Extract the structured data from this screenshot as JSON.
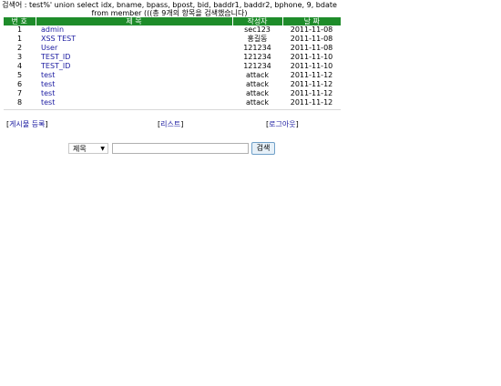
{
  "search_info": {
    "line1": "검색어 : test%' union select idx, bname, bpass, bpost, bid, baddr1, baddr2, bphone, 9, bdate",
    "line2": "from member  (((총 9개의 항목을 검색했습니다)"
  },
  "table": {
    "headers": [
      "번 호",
      "제 목",
      "작성자",
      "날 짜"
    ],
    "rows": [
      {
        "num": "1",
        "title": "admin",
        "writer": "sec123",
        "date": "2011-11-08"
      },
      {
        "num": "1",
        "title": "XSS TEST",
        "writer": "홍길동",
        "date": "2011-11-08"
      },
      {
        "num": "2",
        "title": "User",
        "writer": "121234",
        "date": "2011-11-08"
      },
      {
        "num": "3",
        "title": "TEST_ID",
        "writer": "121234",
        "date": "2011-11-10"
      },
      {
        "num": "4",
        "title": "TEST_ID",
        "writer": "121234",
        "date": "2011-11-10"
      },
      {
        "num": "5",
        "title": "test",
        "writer": "attack",
        "date": "2011-11-12"
      },
      {
        "num": "6",
        "title": "test",
        "writer": "attack",
        "date": "2011-11-12"
      },
      {
        "num": "7",
        "title": "test",
        "writer": "attack",
        "date": "2011-11-12"
      },
      {
        "num": "8",
        "title": "test",
        "writer": "attack",
        "date": "2011-11-12"
      }
    ]
  },
  "links": {
    "write": "게시물 등록",
    "list": "리스트",
    "logout": "로그아웃"
  },
  "search_form": {
    "field_selected": "제목",
    "query_value": "",
    "button_label": "검색"
  },
  "colors": {
    "header_bg": "#1e8c2a",
    "link": "#1a1aa0"
  }
}
